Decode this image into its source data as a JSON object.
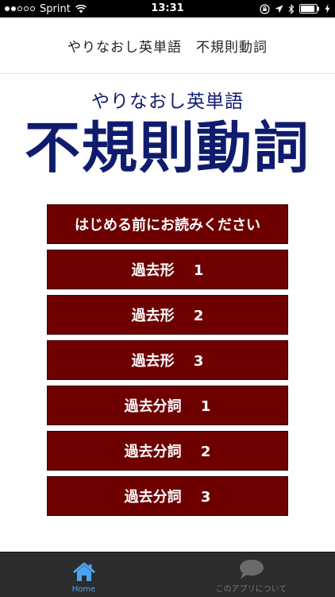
{
  "status_bar": {
    "carrier": "Sprint",
    "time": "13:31",
    "signal_bars_filled": 2,
    "signal_bars_total": 5,
    "battery_level": 0.9
  },
  "header": {
    "title": "やりなおし英単語　不規則動詞"
  },
  "logo": {
    "subtitle": "やりなおし英単語",
    "title": "不規則動詞",
    "color": "#0f1c6e"
  },
  "menu": {
    "button_color": "#6e0000",
    "items": [
      {
        "label": "はじめる前にお読みください"
      },
      {
        "label": "過去形　 1"
      },
      {
        "label": "過去形　 2"
      },
      {
        "label": "過去形　 3"
      },
      {
        "label": "過去分詞　 1"
      },
      {
        "label": "過去分詞　 2"
      },
      {
        "label": "過去分詞　 3"
      }
    ]
  },
  "tab_bar": {
    "tabs": [
      {
        "label": "Home",
        "icon": "home-icon",
        "active": true
      },
      {
        "label": "このアプリについて",
        "icon": "speech-bubble-icon",
        "active": false
      }
    ],
    "active_color": "#4aa3f0"
  }
}
